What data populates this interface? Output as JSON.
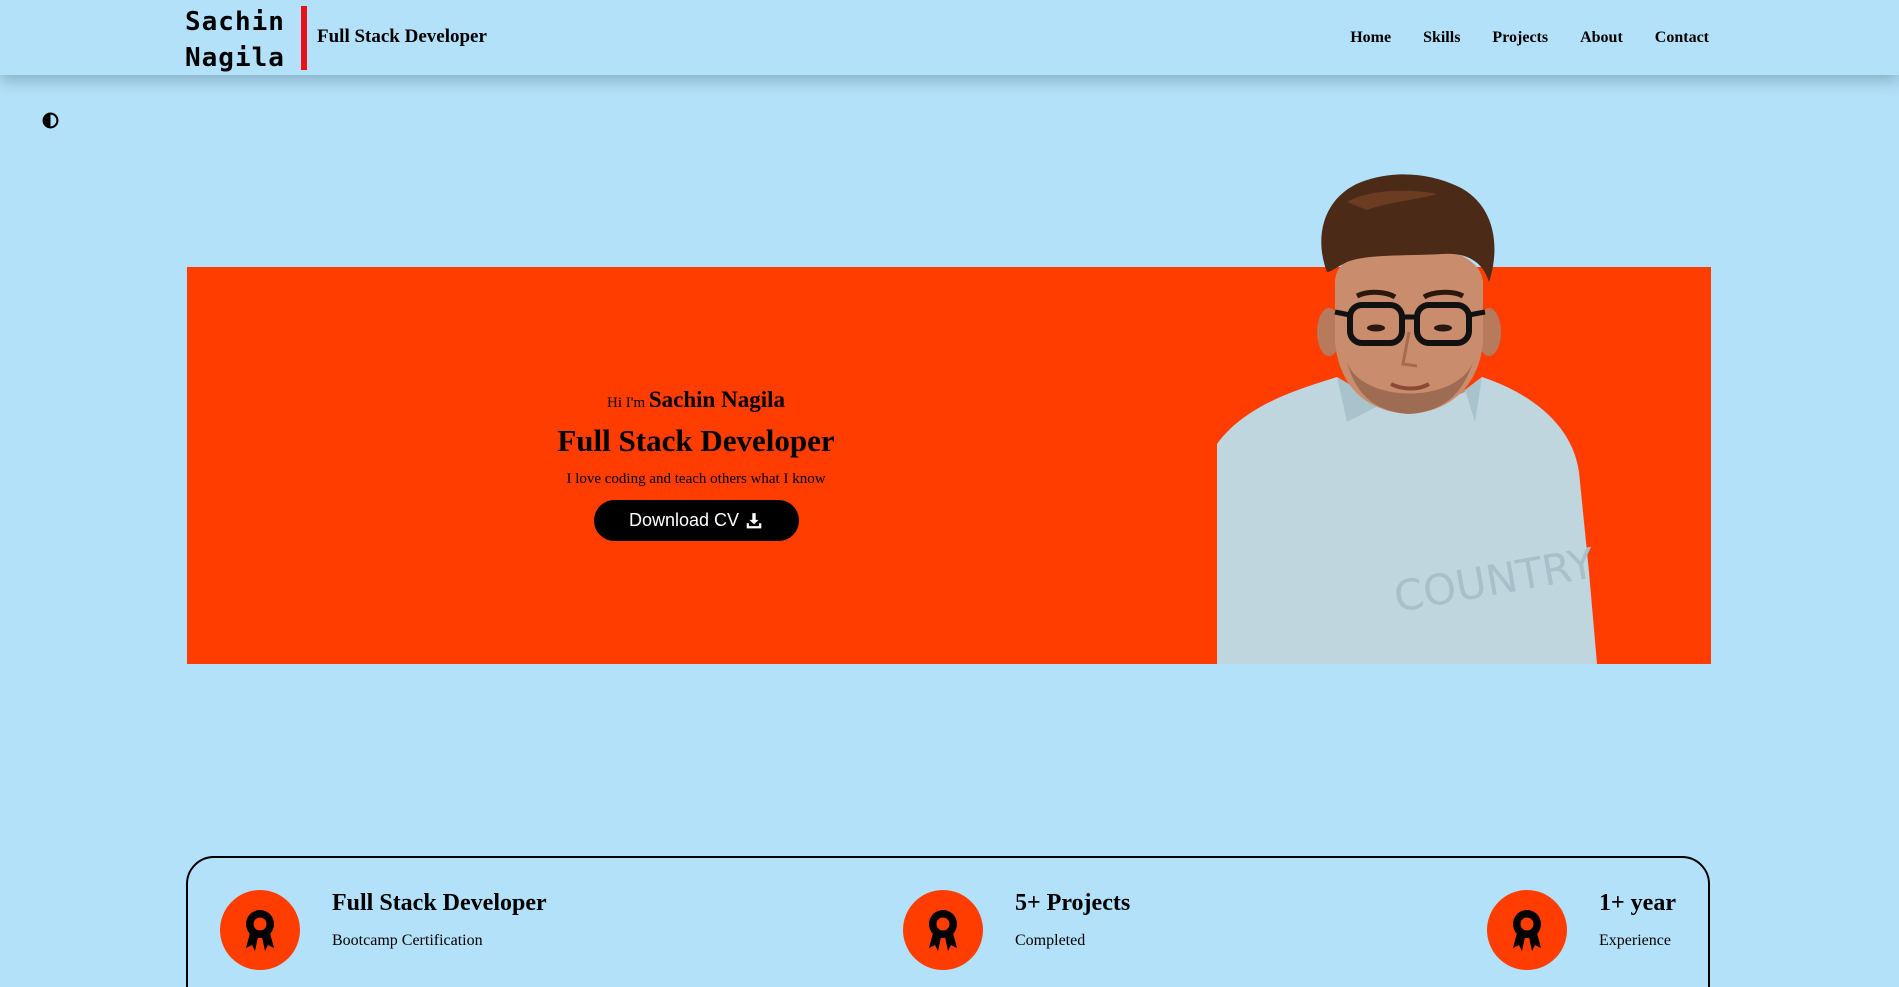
{
  "header": {
    "brand_first": "Sachin",
    "brand_last": "Nagila",
    "role": "Full Stack Developer",
    "nav": [
      "Home",
      "Skills",
      "Projects",
      "About",
      "Contact"
    ]
  },
  "theme_toggle": {
    "icon": "contrast-icon"
  },
  "hero": {
    "greeting": "Hi I'm",
    "name": "Sachin Nagila",
    "role": "Full Stack Developer",
    "tagline": "I love coding and teach others what I know",
    "cv_button": "Download CV",
    "cv_icon": "download-icon",
    "background_color": "#ff3d00"
  },
  "stats": [
    {
      "title": "Full Stack Developer",
      "subtitle": "Bootcamp Certification",
      "icon": "award-icon"
    },
    {
      "title": "5+ Projects",
      "subtitle": "Completed",
      "icon": "award-icon"
    },
    {
      "title": "1+ year",
      "subtitle": "Experience",
      "icon": "award-icon"
    }
  ],
  "colors": {
    "page_background": "#b3e1f9",
    "accent": "#ff3d00",
    "brand_divider": "#e8121b",
    "button_background": "#000000"
  }
}
